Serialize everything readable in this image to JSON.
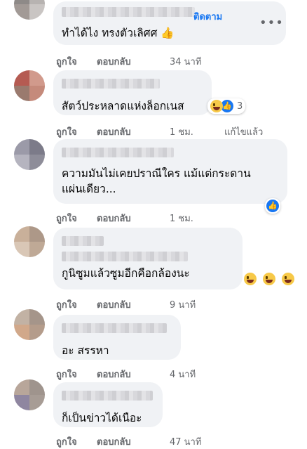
{
  "comments": [
    {
      "text": "ทำได้ไง ทรงตัวเลิศศ 👍",
      "follow": "ติดตาม",
      "like": "ถูกใจ",
      "reply": "ตอบกลับ",
      "time": "34 นาที"
    },
    {
      "text": "สัตว์ประหลาดแห่งล็อกเนส",
      "like": "ถูกใจ",
      "reply": "ตอบกลับ",
      "time": "1 ชม.",
      "edit": "แก้ไขแล้ว",
      "react_count": "3"
    },
    {
      "text1": "ความมันไม่เคยปราณีใคร แม้แต่กระดาน",
      "text2": "แผ่นเดียว...",
      "like": "ถูกใจ",
      "reply": "ตอบกลับ",
      "time": "1 ชม."
    },
    {
      "text": "กูนิซูมแล้วซูมอีกคือกล้องนะ",
      "like": "ถูกใจ",
      "reply": "ตอบกลับ",
      "time": "9 นาที"
    },
    {
      "text": "อะ สรรหา",
      "like": "ถูกใจ",
      "reply": "ตอบกลับ",
      "time": "4 นาที"
    },
    {
      "text": "ก็เป็นข่าวได้เนือะ",
      "like": "ถูกใจ",
      "reply": "ตอบกลับ",
      "time": "47 นาที"
    }
  ],
  "menu_icon": "more-dots-icon",
  "colors": {
    "bubble": "#f0f2f5",
    "link": "#1877f2",
    "meta": "#65676b"
  }
}
